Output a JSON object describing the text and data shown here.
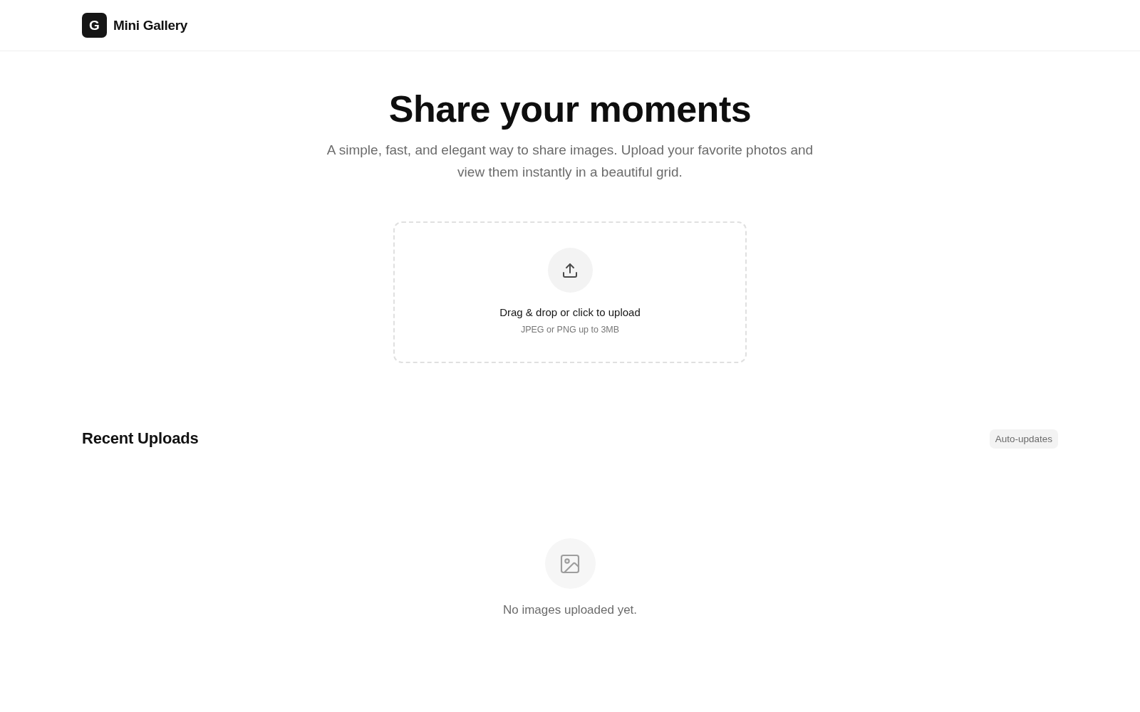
{
  "header": {
    "logo_letter": "G",
    "brand": "Mini Gallery"
  },
  "hero": {
    "title": "Share your moments",
    "subtitle": "A simple, fast, and elegant way to share images. Upload your favorite photos and view them instantly in a beautiful grid."
  },
  "upload": {
    "title": "Drag & drop or click to upload",
    "hint": "JPEG or PNG up to 3MB"
  },
  "recent": {
    "title": "Recent Uploads",
    "badge": "Auto-updates",
    "empty_message": "No images uploaded yet."
  }
}
